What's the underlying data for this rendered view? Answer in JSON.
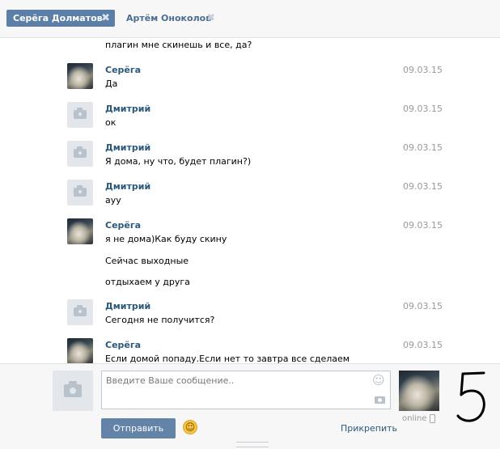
{
  "tabs": [
    {
      "label": "Серёга Долматов",
      "close": "✖"
    },
    {
      "label": "Артём Оноколов",
      "close": "✖"
    }
  ],
  "messages": [
    {
      "author": "",
      "date": "",
      "lines": [
        "плагин мне скинешь и все, да?"
      ]
    },
    {
      "author": "Серёга",
      "date": "09.03.15",
      "lines": [
        "Да"
      ]
    },
    {
      "author": "Дмитрий",
      "date": "09.03.15",
      "lines": [
        "ок"
      ]
    },
    {
      "author": "Дмитрий",
      "date": "09.03.15",
      "lines": [
        "Я дома, ну что, будет плагин?)"
      ]
    },
    {
      "author": "Дмитрий",
      "date": "09.03.15",
      "lines": [
        "ауу"
      ]
    },
    {
      "author": "Серёга",
      "date": "09.03.15",
      "lines": [
        "я не дома)Как буду скину",
        "Сейчас выходные",
        "отдыхаем у друга"
      ]
    },
    {
      "author": "Дмитрий",
      "date": "09.03.15",
      "lines": [
        "Сегодня не получится?"
      ]
    },
    {
      "author": "Серёга",
      "date": "09.03.15",
      "lines": [
        "Если домой попаду.Если нет то завтра все сделаем"
      ]
    }
  ],
  "composer": {
    "placeholder": "Введите Ваше сообщение..",
    "send_label": "Отправить",
    "attach_label": "Прикрепить",
    "peer_status": "online"
  },
  "annotation": "5",
  "icons": {
    "camera": "camera-icon",
    "smile": "smile-icon",
    "photo": "photo-icon",
    "phone": "mobile-phone-icon"
  },
  "colors": {
    "active_tab": "#5b7fa6",
    "link": "#2b587a",
    "send_button": "#6383a8"
  }
}
